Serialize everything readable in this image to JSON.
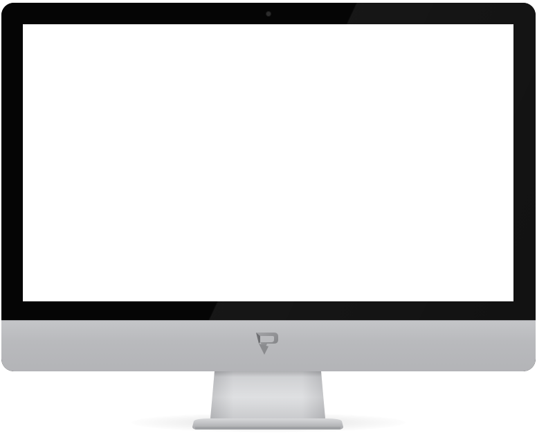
{
  "device": {
    "type": "desktop-monitor",
    "screen_content": "",
    "colors": {
      "bezel": "#050505",
      "screen": "#ffffff",
      "chin": "#b9babd",
      "logo": "#8e8f92"
    },
    "logo_icon": "p-logo-icon"
  }
}
